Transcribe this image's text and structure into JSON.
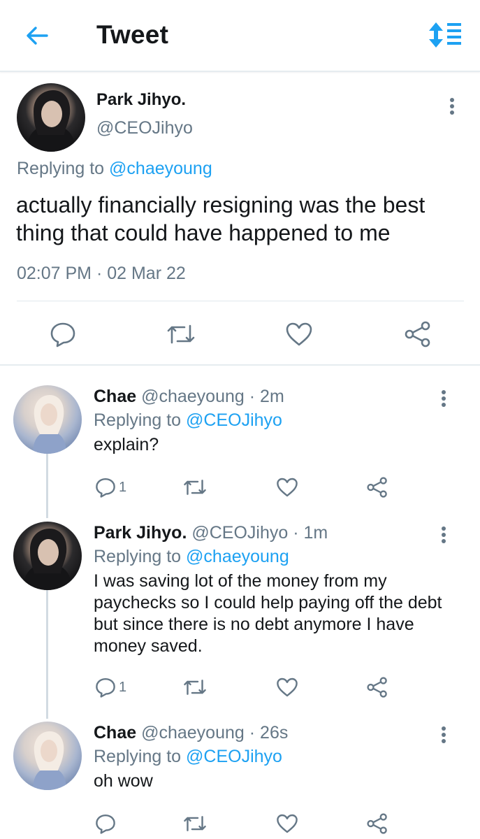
{
  "header": {
    "title": "Tweet",
    "back_icon": "arrow-left-icon",
    "sort_icon": "sort-arrows-icon"
  },
  "colors": {
    "accent": "#1da1f2",
    "text": "#14171a",
    "muted": "#657786",
    "divider": "#e6ecf0"
  },
  "main_tweet": {
    "name": "Park Jihyo.",
    "handle": "@CEOJihyo",
    "replying_label": "Replying to",
    "replying_handle": "@chaeyoung",
    "text": "actually financially resigning was the best thing that could have happened to me",
    "timestamp": "02:07 PM · 02 Mar 22",
    "actions": [
      "reply-icon",
      "retweet-icon",
      "like-icon",
      "share-icon"
    ]
  },
  "replies": [
    {
      "name": "Chae",
      "handle": "@chaeyoung",
      "time": "· 2m",
      "replying_label": "Replying to",
      "replying_handle": "@CEOJihyo",
      "text": "explain?",
      "reply_count": "1"
    },
    {
      "name": "Park Jihyo.",
      "handle": "@CEOJihyo",
      "time": "· 1m",
      "replying_label": "Replying to",
      "replying_handle": "@chaeyoung",
      "text": "I was saving lot of the money from my paychecks so I could help paying off the debt but since there is no debt anymore I have money saved.",
      "reply_count": "1"
    },
    {
      "name": "Chae",
      "handle": "@chaeyoung",
      "time": "· 26s",
      "replying_label": "Replying to",
      "replying_handle": "@CEOJihyo",
      "text": "oh wow",
      "reply_count": ""
    }
  ]
}
